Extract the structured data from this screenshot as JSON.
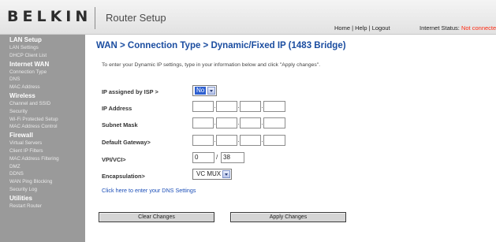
{
  "header": {
    "logo": "BELKIN",
    "title": "Router Setup",
    "links": [
      "Home",
      "Logout"
    ],
    "help_label": "Help",
    "separator": " | ",
    "status_label": "Internet Status:",
    "status_value": "Not connected"
  },
  "sidebar": {
    "sections": [
      {
        "title": "LAN Setup",
        "items": [
          "LAN Settings",
          "DHCP Client List"
        ]
      },
      {
        "title": "Internet WAN",
        "items": [
          "Connection Type",
          "DNS",
          "MAC Address"
        ]
      },
      {
        "title": "Wireless",
        "items": [
          "Channel and SSID",
          "Security",
          "Wi-Fi Protected Setup",
          "MAC Address Control"
        ]
      },
      {
        "title": "Firewall",
        "items": [
          "Virtual Servers",
          "Client IP Filters",
          "MAC Address Filtering",
          "DMZ",
          "DDNS",
          "WAN Ping Blocking",
          "Security Log"
        ]
      },
      {
        "title": "Utilities",
        "items": [
          "Restart Router"
        ]
      }
    ]
  },
  "main": {
    "page_title": "WAN > Connection Type > Dynamic/Fixed IP (1483 Bridge)",
    "intro": "To enter your Dynamic IP settings, type in your information below and click \"Apply changes\".",
    "fields": {
      "ip_assigned_label": "IP assigned by ISP >",
      "ip_assigned_value": "No",
      "ip_address_label": "IP Address",
      "ip_address_values": [
        "",
        "",
        "",
        ""
      ],
      "subnet_label": "Subnet Mask",
      "subnet_values": [
        "",
        "",
        "",
        ""
      ],
      "gateway_label": "Default Gateway>",
      "gateway_values": [
        "",
        "",
        "",
        ""
      ],
      "vpivci_label": "VPI/VCI>",
      "vpi_value": "0",
      "vci_value": "38",
      "encap_label": "Encapsulation>",
      "encap_value": "VC MUX"
    },
    "dns_link": "Click here to enter your DNS Settings",
    "buttons": {
      "clear": "Clear Changes",
      "apply": "Apply Changes"
    }
  },
  "colors": {
    "accent": "#1b4da0",
    "sidebar_bg": "#9a9a9a",
    "status_error": "#ff2a12",
    "link": "#1c4fb8"
  }
}
